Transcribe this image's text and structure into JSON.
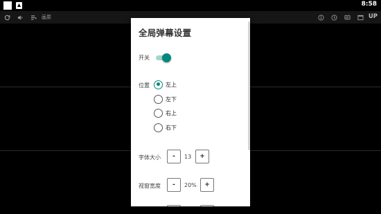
{
  "status_bar": {
    "time": "8:58"
  },
  "toolbar": {
    "quality_label": "画质",
    "upload_label": "UP"
  },
  "dialog": {
    "title": "全局弹幕设置",
    "switch": {
      "label": "开关",
      "on": true
    },
    "position": {
      "label": "位置",
      "options": [
        "左上",
        "左下",
        "右上",
        "右下"
      ],
      "selected": "左上"
    },
    "font_size": {
      "label": "字体大小",
      "decrement": "-",
      "value": "13",
      "increment": "+"
    },
    "window_width": {
      "label": "视窗宽度",
      "decrement": "-",
      "value": "20%",
      "increment": "+"
    }
  },
  "colors": {
    "accent": "#00897b",
    "accent_light": "#a6d4cd",
    "toolbar_bg": "#161616",
    "background": "#000000"
  }
}
